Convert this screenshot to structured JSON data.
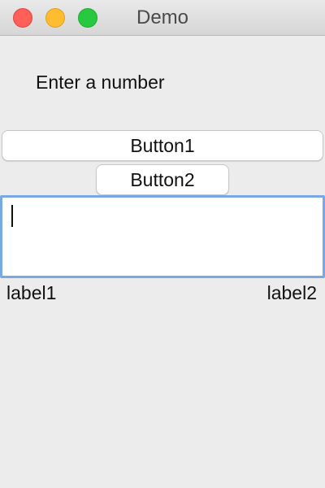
{
  "window": {
    "title": "Demo"
  },
  "prompt": {
    "text": "Enter a number"
  },
  "buttons": {
    "button1": "Button1",
    "button2": "Button2"
  },
  "input": {
    "value": "",
    "placeholder": ""
  },
  "labels": {
    "left": "label1",
    "right": "label2"
  },
  "colors": {
    "background": "#ececec",
    "focus_ring": "#78a8e6",
    "close": "#fe5f57",
    "minimize": "#febc2e",
    "maximize": "#28c840"
  }
}
